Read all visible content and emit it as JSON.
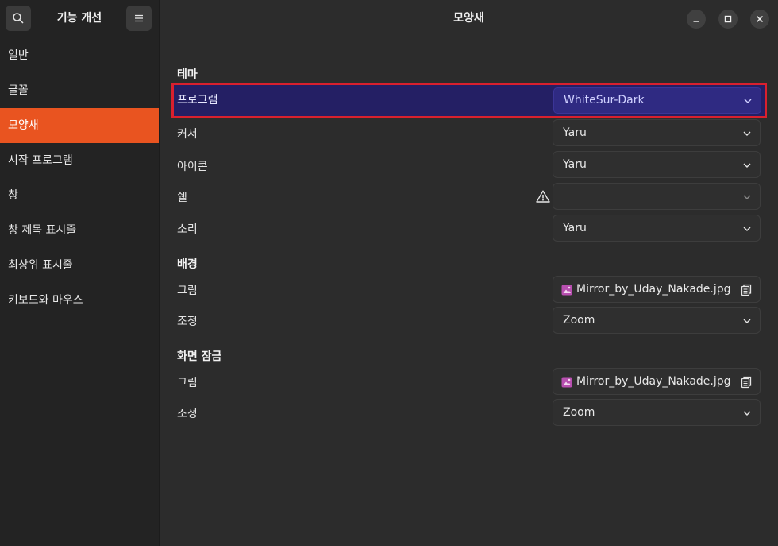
{
  "sidebar": {
    "title": "기능 개선",
    "search_icon": "search-icon",
    "menu_icon": "hamburger-menu-icon",
    "items": [
      {
        "label": "일반"
      },
      {
        "label": "글꼴"
      },
      {
        "label": "모양새"
      },
      {
        "label": "시작 프로그램"
      },
      {
        "label": "창"
      },
      {
        "label": "창 제목 표시줄"
      },
      {
        "label": "최상위 표시줄"
      },
      {
        "label": "키보드와 마우스"
      }
    ],
    "active_item": "모양새",
    "accent_color": "#e95420"
  },
  "window": {
    "title": "모양새",
    "controls": [
      "minimize-icon",
      "maximize-icon",
      "close-icon"
    ]
  },
  "theme": {
    "section": "테마",
    "applications": {
      "label": "프로그램",
      "value": "WhiteSur-Dark"
    },
    "cursor": {
      "label": "커서",
      "value": "Yaru"
    },
    "icons": {
      "label": "아이콘",
      "value": "Yaru"
    },
    "shell": {
      "label": "쉘",
      "value": "",
      "warning_icon": "warning-icon"
    },
    "sound": {
      "label": "소리",
      "value": "Yaru"
    }
  },
  "background": {
    "section": "배경",
    "image": {
      "label": "그림",
      "value": "Mirror_by_Uday_Nakade.jpg"
    },
    "adjustment": {
      "label": "조정",
      "value": "Zoom"
    }
  },
  "lock_screen": {
    "section": "화면 잠금",
    "image": {
      "label": "그림",
      "value": "Mirror_by_Uday_Nakade.jpg"
    },
    "adjustment": {
      "label": "조정",
      "value": "Zoom"
    }
  },
  "colors": {
    "highlight_border": "#d9202e",
    "highlight_fill": "#241f64"
  }
}
